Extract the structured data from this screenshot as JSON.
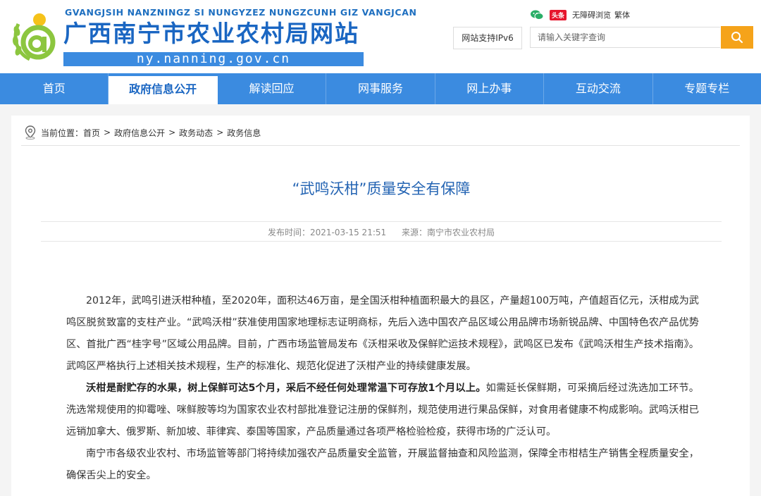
{
  "header": {
    "pinyin": "GVANGJSIH NANZNINGZ SI NUNGYZEZ NUNGZCUNH GIZ VANGJCAN",
    "title": "广西南宁市农业农村局网站",
    "domain": "ny.nanning.gov.cn",
    "tools": {
      "weibo_badge": "头条",
      "accessible": "无障碍浏览",
      "traditional": "繁体"
    },
    "ipv6": "网站支持IPv6",
    "search_placeholder": "请输入关键字查询"
  },
  "nav": {
    "items": [
      "首页",
      "政府信息公开",
      "解读回应",
      "网事服务",
      "网上办事",
      "互动交流",
      "专题专栏"
    ],
    "active_index": 1
  },
  "breadcrumb": {
    "prefix": "当前位置：",
    "items": [
      "首页",
      "政府信息公开",
      "政务动态",
      "政务信息"
    ]
  },
  "article": {
    "title": "“武鸣沃柑”质量安全有保障",
    "publish_time": "发布时间：2021-03-15 21:51",
    "source": "来源：南宁市农业农村局",
    "paragraph1": "2012年，武鸣引进沃柑种植，至2020年，面积达46万亩，是全国沃柑种植面积最大的县区，产量超100万吨，产值超百亿元，沃柑成为武鸣区脱贫致富的支柱产业。“武鸣沃柑”获准使用国家地理标志证明商标，先后入选中国农产品区域公用品牌市场新锐品牌、中国特色农产品优势区、首批广西“桂字号”区域公用品牌。目前，广西市场监管局发布《沃柑采收及保鲜贮运技术规程》，武鸣区已发布《武鸣沃柑生产技术指南》。武鸣区严格执行上述相关技术规程，生产的标准化、规范化促进了沃柑产业的持续健康发展。",
    "paragraph2_bold": "沃柑是耐贮存的水果，树上保鲜可达5个月，采后不经任何处理常温下可存放1个月以上。",
    "paragraph2_rest": "如需延长保鲜期，可采摘后经过洗选加工环节。洗选常规使用的抑霉唑、咪鲜胺等均为国家农业农村部批准登记注册的保鲜剂，规范使用进行果品保鲜，对食用者健康不构成影响。武鸣沃柑已远销加拿大、俄罗斯、新加坡、菲律宾、泰国等国家，产品质量通过各项严格检验检疫，获得市场的广泛认可。",
    "paragraph3": "南宁市各级农业农村、市场监管等部门将持续加强农产品质量安全监管，开展监督抽查和风险监测，保障全市柑桔生产销售全程质量安全，确保舌尖上的安全。"
  },
  "colors": {
    "brand_blue": "#3b8be0",
    "title_blue": "#1a66c2",
    "search_orange": "#f5a31a",
    "logo_green": "#8cc63f"
  }
}
